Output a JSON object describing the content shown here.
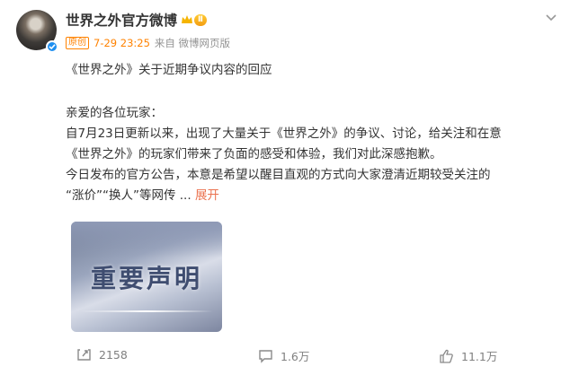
{
  "post": {
    "author": "世界之外官方微博",
    "level": "Ⅱ",
    "badge": "原创",
    "time": "7-29 23:25",
    "source": "来自 微博网页版",
    "title_line": "《世界之外》关于近期争议内容的回应",
    "body": [
      "亲爱的各位玩家：",
      "自7月23日更新以来，出现了大量关于《世界之外》的争议、讨论，给关注和在意",
      "《世界之外》的玩家们带来了负面的感受和体验，我们对此深感抱歉。",
      "今日发布的官方公告，本意是希望以醒目直观的方式向大家澄清近期较受关注的",
      "“涨价”“换人”等网传 ..."
    ],
    "expand_label": "展开",
    "image_title": "重要声明"
  },
  "actions": {
    "repost": "2158",
    "comments": "1.6万",
    "likes": "11.1万"
  },
  "colors": {
    "accent": "#ff8200",
    "link": "#eb7350",
    "verified": "#1f8ff0"
  }
}
